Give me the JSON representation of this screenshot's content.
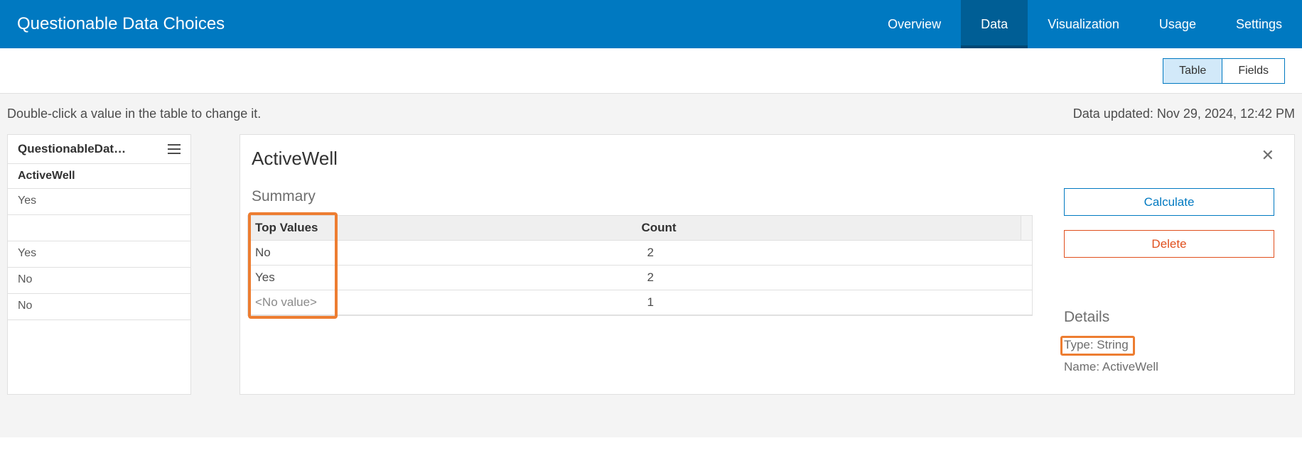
{
  "header": {
    "title": "Questionable Data Choices",
    "nav": [
      "Overview",
      "Data",
      "Visualization",
      "Usage",
      "Settings"
    ],
    "active_nav_index": 1
  },
  "subbar": {
    "toggles": [
      "Table",
      "Fields"
    ],
    "active_toggle_index": 0
  },
  "info": {
    "hint": "Double-click a value in the table to change it.",
    "updated": "Data updated: Nov 29, 2024, 12:42 PM"
  },
  "left_panel": {
    "dataset_label": "QuestionableDat…",
    "column_name": "ActiveWell",
    "rows": [
      "Yes",
      "",
      "Yes",
      "No",
      "No"
    ]
  },
  "field": {
    "name": "ActiveWell",
    "summary_title": "Summary",
    "summary_headers": [
      "Top Values",
      "Count"
    ],
    "summary_rows": [
      {
        "value": "No",
        "count": "2"
      },
      {
        "value": "Yes",
        "count": "2"
      },
      {
        "value": "<No value>",
        "count": "1",
        "muted": true
      }
    ],
    "actions": {
      "calculate": "Calculate",
      "delete": "Delete"
    },
    "details_title": "Details",
    "details": {
      "type_label": "Type: String",
      "name_label": "Name: ActiveWell"
    }
  }
}
